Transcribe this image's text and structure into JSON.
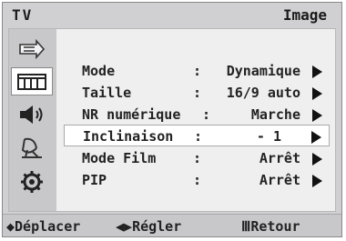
{
  "header": {
    "source": "TV",
    "page": "Image"
  },
  "sidebar": {
    "icons": [
      "input-icon",
      "picture-icon",
      "sound-icon",
      "channel-icon",
      "setup-icon"
    ],
    "active_index": 1
  },
  "menu": {
    "separator": ":",
    "items": [
      {
        "label": "Mode",
        "value": "Dynamique"
      },
      {
        "label": "Taille",
        "value": "16/9 auto"
      },
      {
        "label": "NR numérique",
        "value": "Marche"
      },
      {
        "label": "Inclinaison",
        "value": "- 1"
      },
      {
        "label": "Mode Film",
        "value": "Arrêt"
      },
      {
        "label": "PIP",
        "value": "Arrêt"
      }
    ],
    "selected_index": 3
  },
  "footer": {
    "move": "Déplacer",
    "adjust": "Régler",
    "back": "Retour"
  }
}
